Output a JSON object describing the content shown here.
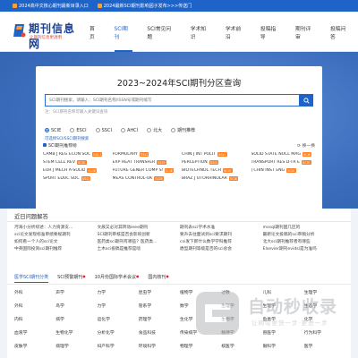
{
  "topbar": {
    "items": [
      {
        "icon": "bell-icon",
        "label": "2024高中文核心期刊最新目录入口"
      },
      {
        "icon": "bell-icon",
        "label": "2024最新SCI期刊影响因子发布>>>传送门"
      }
    ]
  },
  "header": {
    "logo_text": "期刊信息网",
    "logo_sub": "让期刊信息更透明",
    "nav": [
      {
        "label": "首页",
        "active": false
      },
      {
        "label": "SCI期刊",
        "active": true
      },
      {
        "label": "SCI常见问题",
        "active": false
      },
      {
        "label": "学术知识",
        "active": false
      },
      {
        "label": "学术前沿",
        "active": false
      },
      {
        "label": "投稿指导",
        "active": false
      },
      {
        "label": "期刊评审",
        "active": false
      },
      {
        "label": "投稿问答",
        "active": false
      }
    ]
  },
  "search": {
    "title": "2023~2024年SCI期刊分区查询",
    "placeholder": "SCI期刊搜索，请输入：SCI期刊名称/ISSN号或期刊缩写",
    "hint": "注：SCI期刊名称可输入关键词查询",
    "options": [
      {
        "label": "SCIE",
        "selected": true
      },
      {
        "label": "ESCI",
        "selected": false
      },
      {
        "label": "SSCI",
        "selected": false
      },
      {
        "label": "AHCI",
        "selected": false
      },
      {
        "label": "北大",
        "selected": false
      },
      {
        "label": "期刊推荐",
        "selected": false
      }
    ],
    "tip": "可选择SCI/SSCI期刊搜索",
    "recommend_label": "SCI期刊推荐榜",
    "swap_label": "换一换",
    "journals": [
      {
        "name": "CAMB J REG ECON SOC",
        "badge": "SSCI"
      },
      {
        "name": "FORMULARY",
        "badge": "SSCI"
      },
      {
        "name": "CHIN J INT POLIT",
        "badge": "SSCI"
      },
      {
        "name": "SOLID STATE NUCL MAG",
        "badge": "SCIE"
      },
      {
        "name": "STEM CELL REV",
        "badge": "SCIE"
      },
      {
        "name": "EXP HEAT TRANSFER",
        "badge": "SCIE"
      },
      {
        "name": "PERCEPTION",
        "badge": "SSCI"
      },
      {
        "name": "TRANSPORT RES D-TR E",
        "badge": "SCIE"
      },
      {
        "name": "EUR J MECH A-SOLID",
        "badge": "SCIE"
      },
      {
        "name": "FUTURE GENER COMP SY",
        "badge": "SCIE"
      },
      {
        "name": "BIOTECHNOL TECH",
        "badge": "SCIE"
      },
      {
        "name": "J CHIN INST ENG",
        "badge": "SCIE"
      },
      {
        "name": "SPORT EDUC SOC",
        "badge": "SSCI"
      },
      {
        "name": "MEAS CONTROL-UK",
        "badge": "SCIE"
      },
      {
        "name": "BRAZ J OTORHINOLAR",
        "badge": "SCIE"
      }
    ]
  },
  "recent": {
    "title": "近日问题解答",
    "items": [
      "河海小分析综述：人力资源支...",
      "文辰又必对其转动ieee期刊",
      "期刊表sci学术水准",
      "mssql期刊国几区的",
      "sci论文发现标准审绩要规期刊",
      "SCI期刊审核是否会影响创新",
      "要升去往面试到sci要求期刊",
      "最新论文投稿的sci审稿分析",
      "如何看一个人的sci论文",
      "医药类sci期刊有哪些？医药类...",
      "csi发下即什么数学学科推荐",
      "北大sci期刊推荐者有哪些",
      "中英国际投资sci期刊推荐",
      "土木sci投稿是推荐是啥",
      "盾型期刊等级是否的sci总会",
      "Elsevier期刊evidsi是为准吗"
    ]
  },
  "categories": {
    "tabs": [
      {
        "label": "医学SCI期刊分类",
        "active": true,
        "new": false
      },
      {
        "label": "SCI预警期刊",
        "active": false,
        "new": true
      },
      {
        "label": "10月份国际学术会议",
        "active": false,
        "new": true
      },
      {
        "label": "国内核刊",
        "active": false,
        "new": true
      }
    ],
    "items": [
      "外科",
      "声学",
      "力学",
      "昆虫学",
      "植物学",
      "过敏",
      "儿科",
      "生理学",
      "外科",
      "鸟学",
      "力学",
      "管系学",
      "数学",
      "生理学",
      "生理学",
      "生态学",
      "内科",
      "病学",
      "运化学",
      "药理学",
      "生化学",
      "生物学",
      "鱼类学",
      "化学",
      "血液学",
      "生物化学",
      "分析化学",
      "食品科技",
      "传染病学",
      "精神学",
      "兽医学",
      "行为科学",
      "皮肤学",
      "病理学",
      "妇产科学",
      "环境科学",
      "物理学",
      "核医学",
      "眼科学",
      "医学"
    ]
  },
  "watermark": {
    "title": "自动秒收录",
    "sub": "让网站更快一步·更进一步"
  },
  "colors": {
    "primary": "#1e63c8",
    "badge": "#ff7d1f",
    "hero": "#3f73c2"
  }
}
